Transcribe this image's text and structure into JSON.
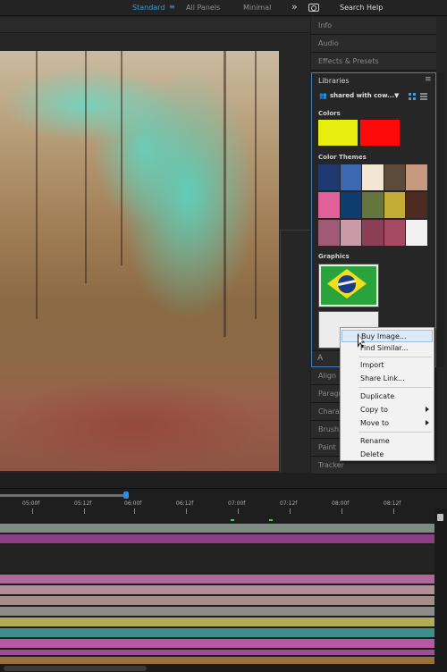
{
  "workspace": {
    "standard": "Standard",
    "menu_glyph": "≡",
    "all_panels": "All Panels",
    "minimal": "Minimal",
    "overflow": "»",
    "search_help": "Search Help"
  },
  "panels": {
    "info": "Info",
    "audio": "Audio",
    "effects_presets": "Effects & Presets",
    "align": "Align",
    "paragraph": "Paragr",
    "character": "Chara",
    "brushes": "Brush",
    "paint": "Paint",
    "tracker": "Tracker"
  },
  "libraries": {
    "title": "Libraries",
    "menu": "≡",
    "selected_library": "shared with cow...",
    "caret": "▼",
    "sections": {
      "colors": "Colors",
      "color_themes": "Color Themes",
      "graphics": "Graphics"
    },
    "colors": [
      "#e8ee10",
      "#ff0a0a"
    ],
    "color_themes": [
      [
        "#1f3a72",
        "#3d67b0",
        "#f3e6d3",
        "#5c4a3b",
        "#c79a80"
      ],
      [
        "#e2609a",
        "#0f3c6e",
        "#64753e",
        "#c4ad37",
        "#4d2a22"
      ],
      [
        "#a05a74",
        "#c99aa8",
        "#8c3e56",
        "#a54a62",
        "#f2f0f0"
      ]
    ],
    "footer_icon": "A"
  },
  "context_menu": {
    "items": [
      {
        "label": "Buy Image...",
        "highlighted": true
      },
      {
        "label": "Find Similar...",
        "highlighted": false
      },
      {
        "label": "Import",
        "highlighted": false
      },
      {
        "label": "Share Link...",
        "highlighted": false
      },
      {
        "label": "Duplicate",
        "highlighted": false
      },
      {
        "label": "Copy to",
        "submenu": true
      },
      {
        "label": "Move to",
        "submenu": true
      },
      {
        "label": "Rename",
        "highlighted": false
      },
      {
        "label": "Delete",
        "highlighted": false
      }
    ]
  },
  "timeline": {
    "ruler": [
      "05:00f",
      "05:12f",
      "06:00f",
      "06:12f",
      "07:00f",
      "07:12f",
      "08:00f",
      "08:12f"
    ],
    "track_colors": [
      "#7f8c86",
      "#8b3f86",
      "#232323",
      "#ad6a99",
      "#b28f96",
      "#a88b86",
      "#8e8c87",
      "#b2ab57",
      "#3e8e8c",
      "#b55aa2",
      "#9d4f96",
      "#9a6f3e"
    ]
  },
  "colors": {
    "accent": "#3d9ee0"
  }
}
